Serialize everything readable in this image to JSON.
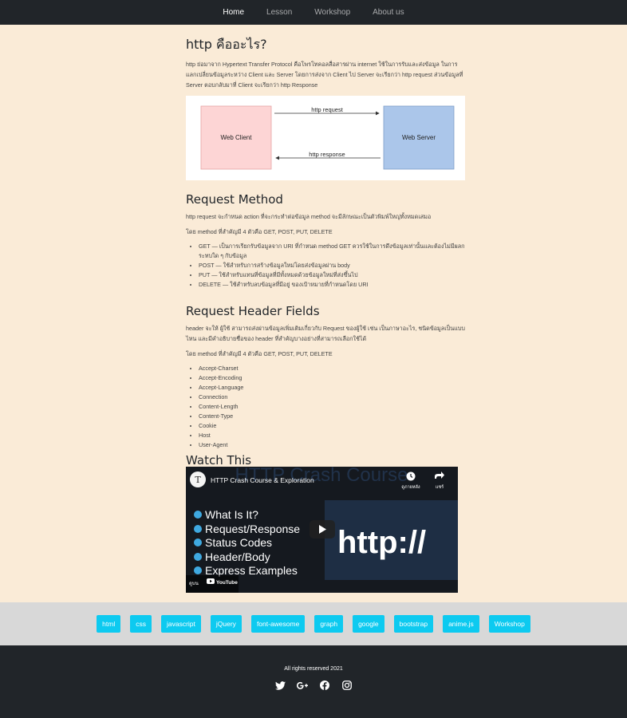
{
  "nav": {
    "items": [
      "Home",
      "Lesson",
      "Workshop",
      "About us"
    ]
  },
  "intro": {
    "title": "http คืออะไร?",
    "text": "http ย่อมาจาก Hypertext Transfer Protocol คือโพรโทคอลสื่อสารผ่าน internet ใช้ในการรับและส่งข้อมูล ในการแลกเปลี่ยนข้อมูลระหว่าง Client และ Server โดยการส่งจาก Client ไป Server จะเรียกว่า http request ส่วนข้อมูลที่ Server ตอบกลับมาที่ Client จะเรียกว่า http Response"
  },
  "diagram": {
    "client": "Web Client",
    "server": "Web Server",
    "request": "http request",
    "response": "http response"
  },
  "method": {
    "title": "Request Method",
    "text": "http request จะกำหนด action ที่จะกระทำต่อข้อมูล method จะมีลักษณะเป็นตัวพิมพ์ใหญ่ทั้งหมดเสมอ",
    "text2": "โดย method ที่สำคัญมี 4 ตัวคือ GET, POST, PUT, DELETE",
    "items": [
      "GET — เป็นการเรียกรับข้อมูลจาก URI ที่กำหนด method GET ควรใช้ในการดึงข้อมูลเท่านั้นและต้องไม่มีผลกระทบใด ๆ กับข้อมูล",
      "POST — ใช้สำหรับการสร้างข้อมูลใหม่โดยส่งข้อมูลผ่าน body",
      "PUT — ใช้สำหรับแทนที่ข้อมูลที่มีทั้งหมดด้วยข้อมูลใหม่ที่ส่งขึ้นไป",
      "DELETE — ใช้สำหรับลบข้อมูลที่มีอยู่ ของเป้าหมายที่กำหนดโดย URI"
    ]
  },
  "header": {
    "title": "Request Header Fields",
    "text": "header จะให้ ผู้ใช้ สามารถส่งผ่านข้อมูลเพิ่มเติมเกี่ยวกับ Request ของผู้ใช้ เช่น เป็นภาษาอะไร, ชนิดข้อมูลเป็นแบบไหน และมีคำอธิบายชื่อของ header ที่สำคัญบางอย่างที่สามารถเลือกใช้ได้",
    "text2": "โดย method ที่สำคัญมี 4 ตัวคือ GET, POST, PUT, DELETE",
    "items": [
      "Accept-Charset",
      "Accept-Encoding",
      "Accept-Language",
      "Connection",
      "Content-Length",
      "Content-Type",
      "Cookie",
      "Host",
      "User-Agent"
    ]
  },
  "watch": {
    "title": "Watch This",
    "video_title": "HTTP Crash Course & Exploration",
    "bg_text": "HTTP Crash Course",
    "watch_later": "ดูภายหลัง",
    "share": "แชร์",
    "bullets": [
      "What Is It?",
      "Request/Response",
      "Status Codes",
      "Header/Body",
      "Express Examples"
    ],
    "big_text": "http://",
    "watch_on": "ดูบน",
    "youtube": "YouTube",
    "channel_letter": "T"
  },
  "tags": [
    "html",
    "css",
    "javascript",
    "jQuery",
    "font-awesome",
    "graph",
    "google",
    "bootstrap",
    "anime.js",
    "Workshop"
  ],
  "footer": {
    "copyright": "All rights reserved 2021",
    "icons": [
      "twitter-icon",
      "google-plus-icon",
      "facebook-icon",
      "instagram-icon"
    ]
  },
  "colors": {
    "background": "#faebd7",
    "nav": "#212529",
    "tag": "#0dcaf0",
    "tag_bar": "#d8d8d8",
    "client_box": "#fdd5d5",
    "server_box": "#abc6ea"
  }
}
